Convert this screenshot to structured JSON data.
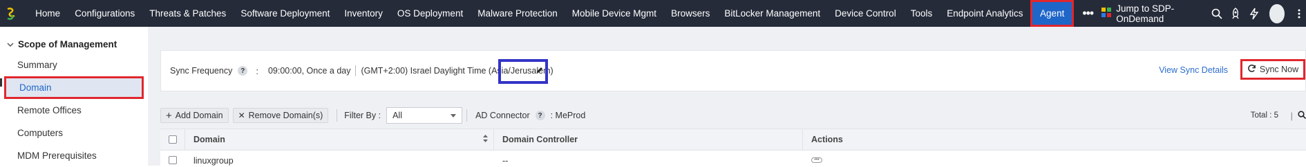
{
  "nav": {
    "items": [
      {
        "label": "Home"
      },
      {
        "label": "Configurations"
      },
      {
        "label": "Threats & Patches"
      },
      {
        "label": "Software Deployment"
      },
      {
        "label": "Inventory"
      },
      {
        "label": "OS Deployment"
      },
      {
        "label": "Malware Protection"
      },
      {
        "label": "Mobile Device Mgmt"
      },
      {
        "label": "Browsers"
      },
      {
        "label": "BitLocker Management"
      },
      {
        "label": "Device Control"
      },
      {
        "label": "Tools"
      },
      {
        "label": "Endpoint Analytics"
      },
      {
        "label": "Agent"
      }
    ],
    "active": "Agent",
    "more": "•••",
    "jump_label": "Jump to SDP-OnDemand"
  },
  "sidebar": {
    "heading": "Scope of Management",
    "items": [
      {
        "label": "Summary"
      },
      {
        "label": "Domain"
      },
      {
        "label": "Remote Offices"
      },
      {
        "label": "Computers"
      },
      {
        "label": "MDM Prerequisites"
      }
    ],
    "active": "Domain"
  },
  "sync": {
    "label": "Sync Frequency",
    "help": "?",
    "colon": ":",
    "time": "09:00:00, Once a day",
    "timezone": "(GMT+2:00) Israel Daylight Time (Asia/Jerusalem)",
    "view_details": "View Sync Details",
    "sync_now": "Sync Now"
  },
  "toolbar": {
    "add_domain": "Add Domain",
    "remove_domain": "Remove Domain(s)",
    "filter_label": "Filter By :",
    "filter_value": "All",
    "ad_connector_label": "AD Connector",
    "ad_connector_help": "?",
    "ad_connector_value": ": MeProd",
    "total": "Total : 5",
    "total_sep": "|"
  },
  "table": {
    "columns": [
      "Domain",
      "Domain Controller",
      "Actions"
    ],
    "rows": [
      {
        "domain": "linuxgroup",
        "controller": "--",
        "actions": "•••"
      }
    ]
  },
  "colors": {
    "topbar": "#252b39",
    "accent": "#1f66c9",
    "highlight_red": "#e0272d",
    "highlight_blue": "#3333c7"
  }
}
